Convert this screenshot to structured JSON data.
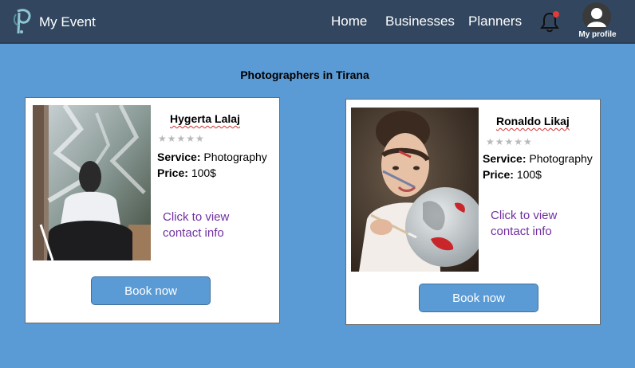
{
  "nav": {
    "app_title": "My Event",
    "links": [
      "Home",
      "Businesses",
      "Planners"
    ],
    "profile_label": "My profile",
    "notification_color": "#e23b3b"
  },
  "page": {
    "title": "Photographers in Tirana"
  },
  "cards": [
    {
      "name": "Hygerta Lalaj",
      "rating_stars": "★★★★★",
      "rating": 0,
      "service_label": "Service:",
      "service": "Photography",
      "price_label": "Price:",
      "price": "100$",
      "contact_link": "Click to view contact info",
      "book_label": "Book now"
    },
    {
      "name": "Ronaldo Likaj",
      "rating_stars": "★★★★★",
      "rating": 0,
      "service_label": "Service:",
      "service": "Photography",
      "price_label": "Price:",
      "price": "100$",
      "contact_link": "Click to view contact info",
      "book_label": "Book now"
    }
  ]
}
